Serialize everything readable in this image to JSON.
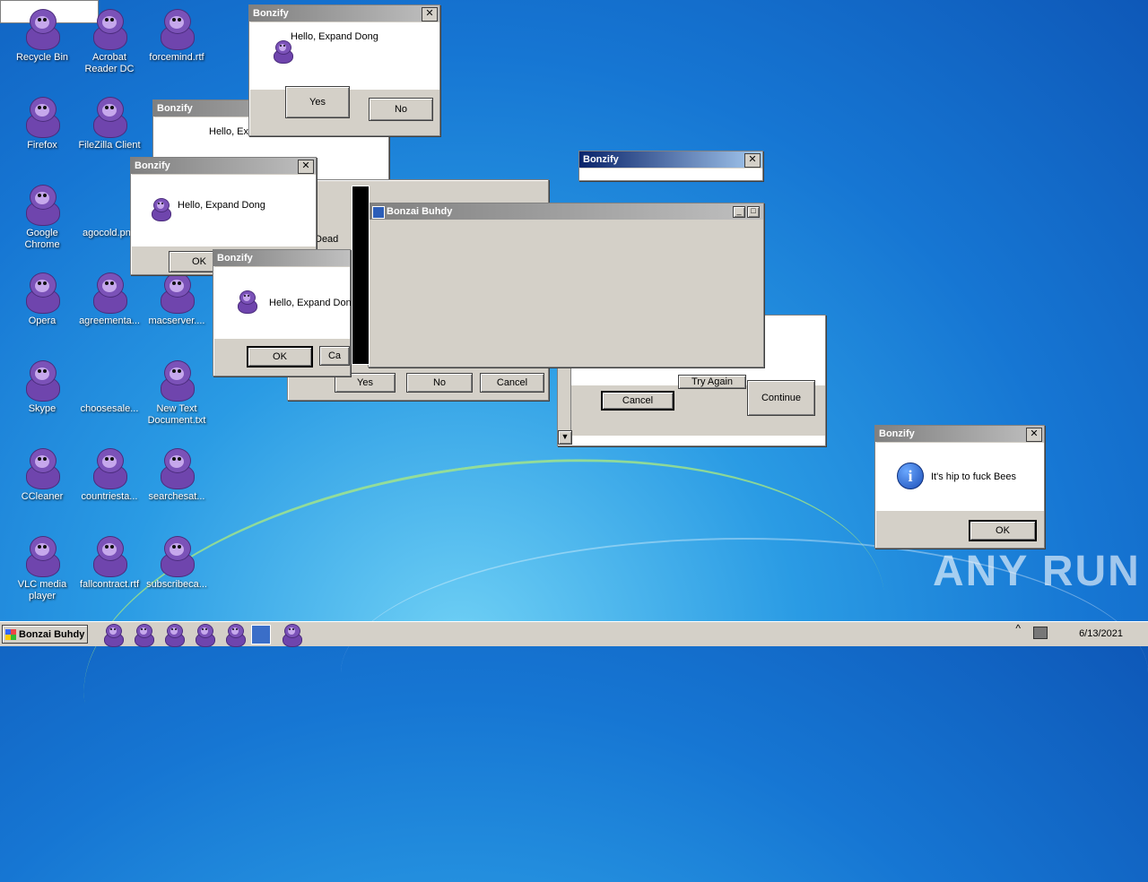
{
  "desktop_icons": [
    {
      "label": "Recycle Bin"
    },
    {
      "label": "Acrobat Reader DC"
    },
    {
      "label": "forcemind.rtf"
    },
    {
      "label": "Firefox"
    },
    {
      "label": "FileZilla Client"
    },
    {
      "label": "Google Chrome"
    },
    {
      "label": "agocold.png"
    },
    {
      "label": "Opera"
    },
    {
      "label": "agreementa..."
    },
    {
      "label": "macserver...."
    },
    {
      "label": "Skype"
    },
    {
      "label": "choosesale..."
    },
    {
      "label": "New Text Document.txt"
    },
    {
      "label": "CCleaner"
    },
    {
      "label": "countriesta..."
    },
    {
      "label": "searchesat..."
    },
    {
      "label": "VLC media player"
    },
    {
      "label": "fallcontract.rtf"
    },
    {
      "label": "subscribeca..."
    }
  ],
  "dialogs": {
    "top": {
      "title": "Bonzify",
      "message": "Hello, Expand Dong",
      "yes": "Yes",
      "no": "No"
    },
    "back": {
      "title": "Bonzify",
      "message": "Hello, Exp"
    },
    "left": {
      "title": "Bonzify",
      "message": "Hello, Expand Dong",
      "ok": "OK"
    },
    "mid": {
      "title": "Bonzify",
      "message": "Hello, Expand Don",
      "ok": "OK",
      "cancel": "Ca"
    },
    "frag_text": "Dead",
    "ync": {
      "yes": "Yes",
      "no": "No",
      "cancel": "Cancel"
    },
    "blue": {
      "title": "Bonzify"
    },
    "main": {
      "title": "Bonzai Buhdy"
    },
    "retry": {
      "cancel": "Cancel",
      "try_again": "Try Again",
      "continue": "Continue"
    },
    "bees": {
      "title": "Bonzify",
      "message": "It's hip to fuck Bees",
      "ok": "OK"
    }
  },
  "taskbar": {
    "start_label": "Bonzai Buhdy",
    "date": "6/13/2021"
  },
  "watermark": "ANY RUN"
}
